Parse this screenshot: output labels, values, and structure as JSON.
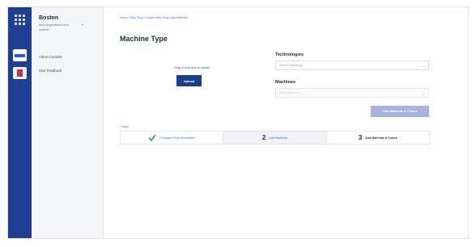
{
  "sidebar": {
    "city": "Boston",
    "email": "taiwo@greyband.com",
    "org": "Adhere",
    "nav": [
      {
        "label": "Admin Console"
      },
      {
        "label": "Give Feedback"
      }
    ]
  },
  "breadcrumb": "Home / Bill's Shop / Create New Shop / Add Machine",
  "page": {
    "title": "Machine Type",
    "drop_hint": "Drag & drop here to upload",
    "upload_label": "Upload"
  },
  "form": {
    "technologies_label": "Technologies",
    "technologies_placeholder": "Select Technology",
    "machines_label": "Machines",
    "machines_placeholder": "Select Machine",
    "add_button": "Add Materials & Colors"
  },
  "back_label": "< Back",
  "stepper": [
    {
      "number": "",
      "label": "Complete Shop Information",
      "state": "done"
    },
    {
      "number": "2",
      "label": "Add Machines",
      "state": "active"
    },
    {
      "number": "3",
      "label": "Add Materials & Colors",
      "state": "pending"
    }
  ],
  "colors": {
    "rail": "#1f3f94",
    "primary": "#1c3d8f",
    "disabled_button": "#a6b4dd",
    "link": "#3c6fd8",
    "check": "#3aa655"
  },
  "icons": [
    "apps-grid-icon",
    "window-icon",
    "shop-icon",
    "chevron-down-icon",
    "check-icon"
  ]
}
